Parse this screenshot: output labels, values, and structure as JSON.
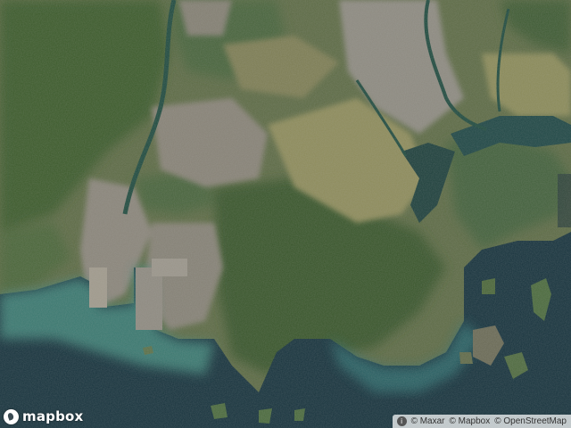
{
  "map": {
    "type": "satellite",
    "colors": {
      "sea_deep": "#15313b",
      "sea_shallow": "#4a8a82",
      "mountain": "#3d5a2e",
      "farmland": "#8a8c5c",
      "urban": "#8a8578",
      "river": "#1f4a3e"
    }
  },
  "logo": {
    "icon": "mapbox-logo-icon",
    "text": "mapbox"
  },
  "attribution": {
    "info_icon": "info-icon",
    "items": [
      "© Maxar",
      "© Mapbox",
      "© OpenStreetMap"
    ]
  }
}
